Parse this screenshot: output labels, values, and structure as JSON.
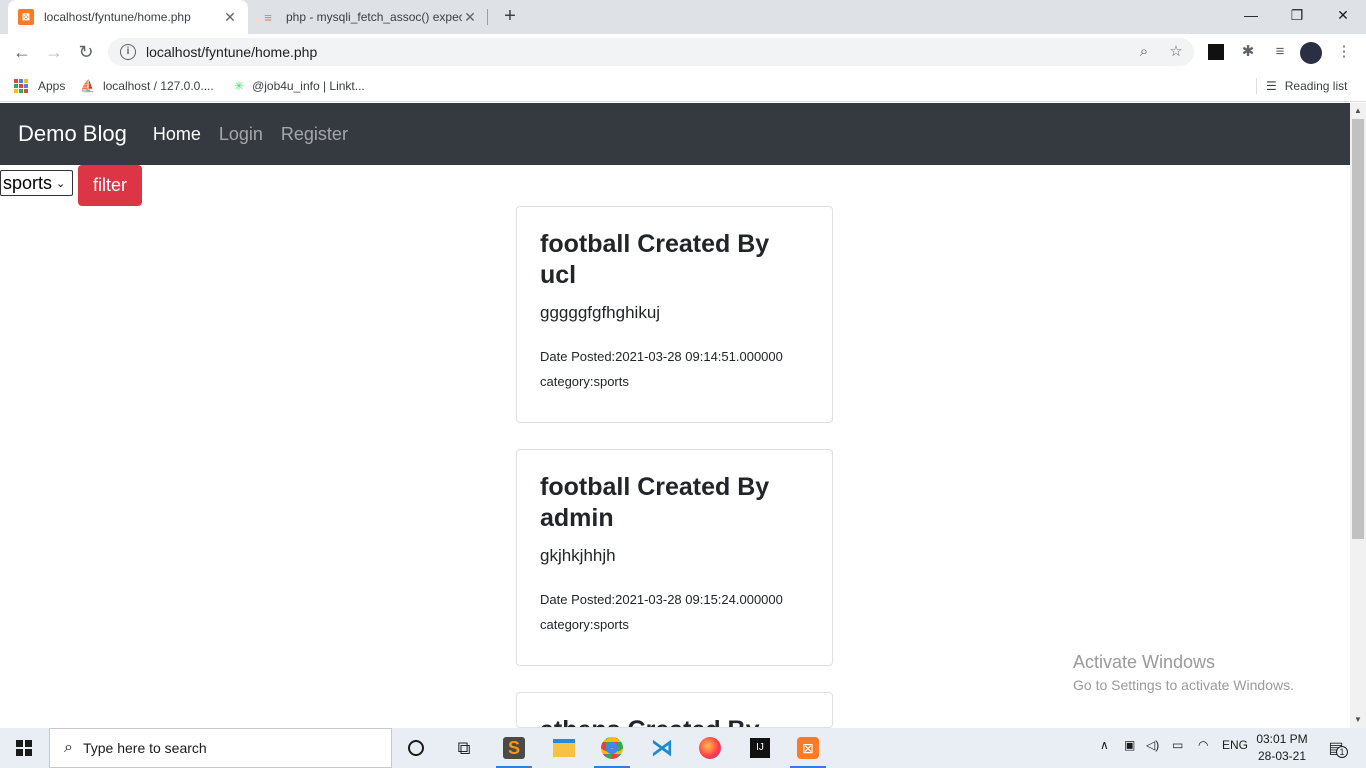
{
  "browser": {
    "tabs": [
      {
        "title": "localhost/fyntune/home.php",
        "active": true
      },
      {
        "title": "php - mysqli_fetch_assoc() expec",
        "active": false
      }
    ],
    "url": "localhost/fyntune/home.php",
    "bookmarks": [
      {
        "label": "Apps"
      },
      {
        "label": "localhost / 127.0.0...."
      },
      {
        "label": "@job4u_info | Linkt..."
      }
    ],
    "reading_list": "Reading list"
  },
  "navbar": {
    "brand": "Demo Blog",
    "links": [
      {
        "label": "Home",
        "active": true
      },
      {
        "label": "Login",
        "active": false
      },
      {
        "label": "Register",
        "active": false
      }
    ]
  },
  "filter": {
    "selected": "sports",
    "button_label": "filter"
  },
  "posts": [
    {
      "title": "football Created By ucl",
      "body": "gggggfgfhghikuj",
      "date": "Date Posted:2021-03-28 09:14:51.000000",
      "category": "category:sports"
    },
    {
      "title": "football Created By admin",
      "body": "gkjhkjhhjh",
      "date": "Date Posted:2021-03-28 09:15:24.000000",
      "category": "category:sports"
    },
    {
      "title": "athens Created By",
      "body": "",
      "date": "",
      "category": ""
    }
  ],
  "watermark": {
    "line1": "Activate Windows",
    "line2": "Go to Settings to activate Windows."
  },
  "taskbar": {
    "search_placeholder": "Type here to search",
    "language": "ENG",
    "time": "03:01 PM",
    "date": "28-03-21",
    "notification_count": "1"
  },
  "colors": {
    "navbar_bg": "#343a40",
    "filter_button": "#dc3545",
    "tab_strip": "#dee1e6"
  }
}
